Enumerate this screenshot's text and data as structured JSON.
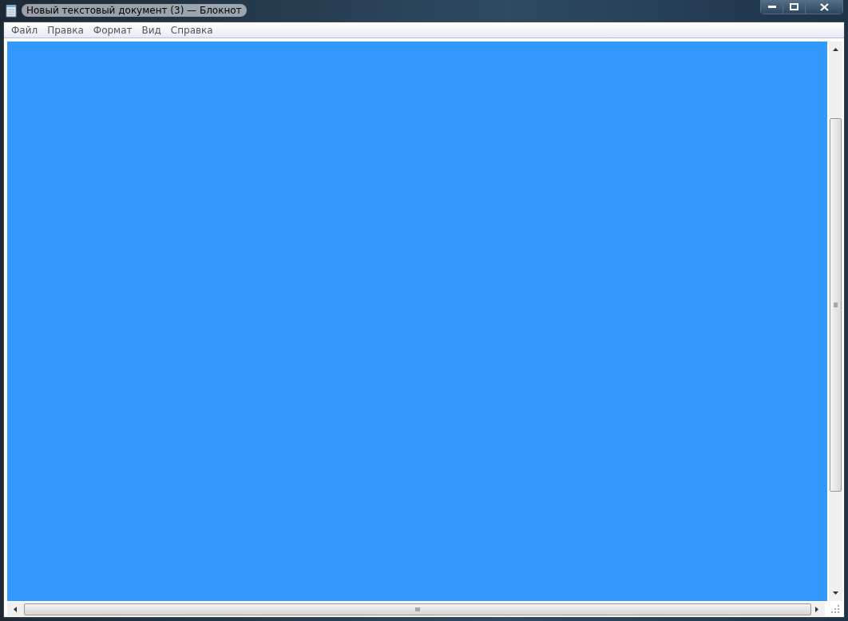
{
  "window": {
    "title": "Новый текстовый документ (3) — Блокнот"
  },
  "menu": [
    {
      "label": "Файл"
    },
    {
      "label": "Правка"
    },
    {
      "label": "Формат"
    },
    {
      "label": "Вид"
    },
    {
      "label": "Справка"
    }
  ],
  "editor": {
    "selected": true
  }
}
